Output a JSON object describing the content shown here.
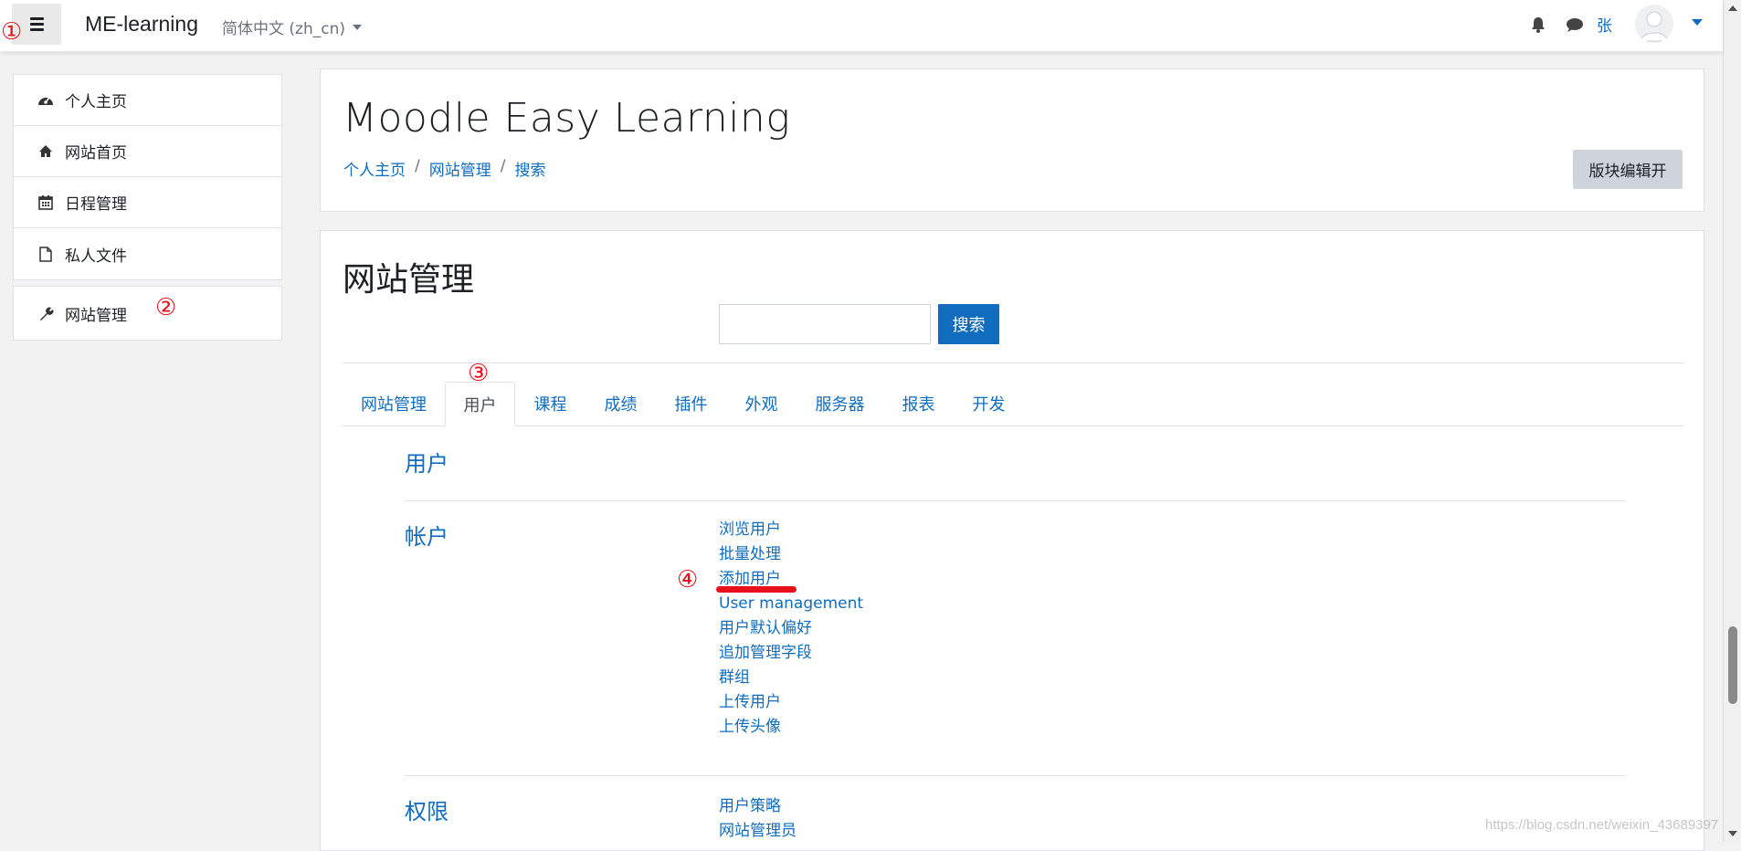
{
  "navbar": {
    "brand": "ME-learning",
    "language": "简体中文 (zh_cn)",
    "user_name": "张",
    "icons": {
      "menu": "hamburger-icon",
      "notifications": "bell-icon",
      "messages": "chat-icon",
      "user_menu": "chevron-down-icon"
    }
  },
  "drawer": {
    "items": [
      {
        "label": "个人主页",
        "icon": "dashboard-icon"
      },
      {
        "label": "网站首页",
        "icon": "home-icon"
      },
      {
        "label": "日程管理",
        "icon": "calendar-icon"
      },
      {
        "label": "私人文件",
        "icon": "file-icon"
      }
    ],
    "admin": {
      "label": "网站管理",
      "icon": "wrench-icon"
    }
  },
  "header": {
    "title": "Moodle Easy Learning",
    "breadcrumb": [
      "个人主页",
      "网站管理",
      "搜索"
    ],
    "edit_button": "版块编辑开"
  },
  "main": {
    "heading": "网站管理",
    "search_value": "",
    "search_button": "搜索",
    "tabs": [
      "网站管理",
      "用户",
      "课程",
      "成绩",
      "插件",
      "外观",
      "服务器",
      "报表",
      "开发"
    ],
    "active_tab": "用户",
    "sections": [
      {
        "title": "用户",
        "links": []
      },
      {
        "title": "帐户",
        "links": [
          "浏览用户",
          "批量处理",
          "添加用户",
          "User management",
          "用户默认偏好",
          "追加管理字段",
          "群组",
          "上传用户",
          "上传头像"
        ]
      },
      {
        "title": "权限",
        "links": [
          "用户策略",
          "网站管理员"
        ]
      }
    ]
  },
  "annotations": [
    "①",
    "②",
    "③",
    "④"
  ],
  "watermark": "https://blog.csdn.net/weixin_43689397",
  "colors": {
    "link": "#0f6cbf",
    "primary_button": "#0f6cbf",
    "annotation": "#e8101a",
    "background": "#f2f2f2"
  }
}
